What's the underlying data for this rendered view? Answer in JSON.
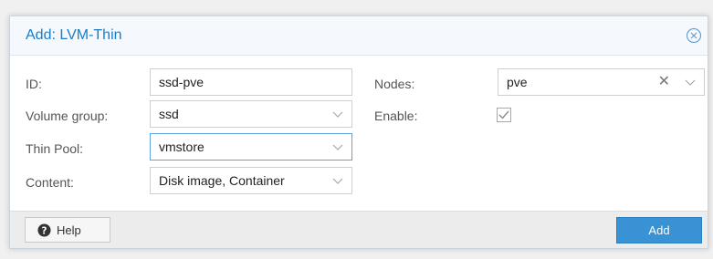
{
  "dialog": {
    "title": "Add: LVM-Thin",
    "accent_color": "#157fcc"
  },
  "form": {
    "id": {
      "label": "ID:",
      "value": "ssd-pve"
    },
    "volume_group": {
      "label": "Volume group:",
      "value": "ssd"
    },
    "thin_pool": {
      "label": "Thin Pool:",
      "value": "vmstore"
    },
    "content": {
      "label": "Content:",
      "value": "Disk image, Container"
    },
    "nodes": {
      "label": "Nodes:",
      "value": "pve"
    },
    "enable": {
      "label": "Enable:",
      "checked": true
    }
  },
  "footer": {
    "help_label": "Help",
    "add_label": "Add",
    "add_color": "#3892d4"
  },
  "icons": {
    "close": "close-circle-icon",
    "help": "question-circle-icon",
    "dropdown": "chevron-down-icon",
    "clear": "clear-x-icon",
    "checkbox": "checkbox-checked-icon"
  }
}
